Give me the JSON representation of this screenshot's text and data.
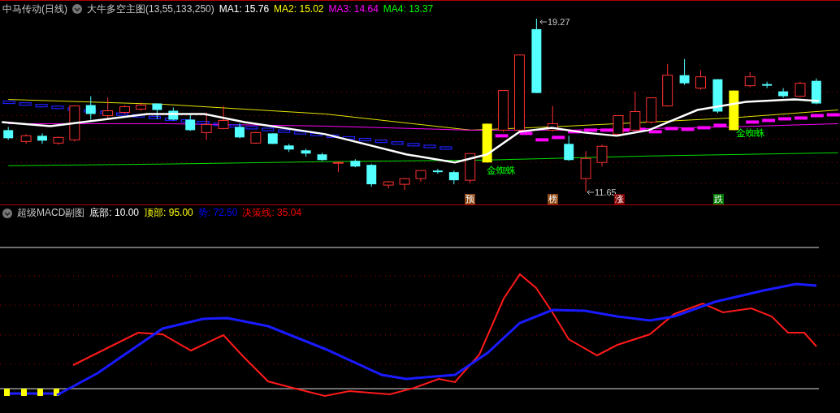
{
  "main_panel": {
    "stock": "中马传动(日线)",
    "indicator": "大牛多空主图(13,55,133,250)",
    "values": [
      {
        "label": "MA1: 15.76",
        "color": "#ffffff"
      },
      {
        "label": "MA2: 15.02",
        "color": "#ffff00"
      },
      {
        "label": "MA3: 14.64",
        "color": "#ff00ff"
      },
      {
        "label": "MA4: 13.37",
        "color": "#00ff00"
      }
    ],
    "price_labels": [
      "19.27",
      "11.65"
    ],
    "pattern_labels": [
      "金蜘蛛",
      "金蜘蛛"
    ],
    "signal_tags": [
      {
        "text": "预",
        "color": "#8b4513"
      },
      {
        "text": "榜",
        "color": "#8b4513"
      },
      {
        "text": "涨",
        "color": "#800000"
      },
      {
        "text": "跌",
        "color": "#007a00"
      }
    ]
  },
  "sub_panel": {
    "indicator": "超级MACD副图",
    "values": [
      {
        "label": "底部: 10.00",
        "color": "#ffffff"
      },
      {
        "label": "顶部: 95.00",
        "color": "#ffff00"
      },
      {
        "label": "势: 72.50",
        "color": "#0000ff"
      },
      {
        "label": "决策线: 35.04",
        "color": "#ff0000"
      }
    ]
  }
}
